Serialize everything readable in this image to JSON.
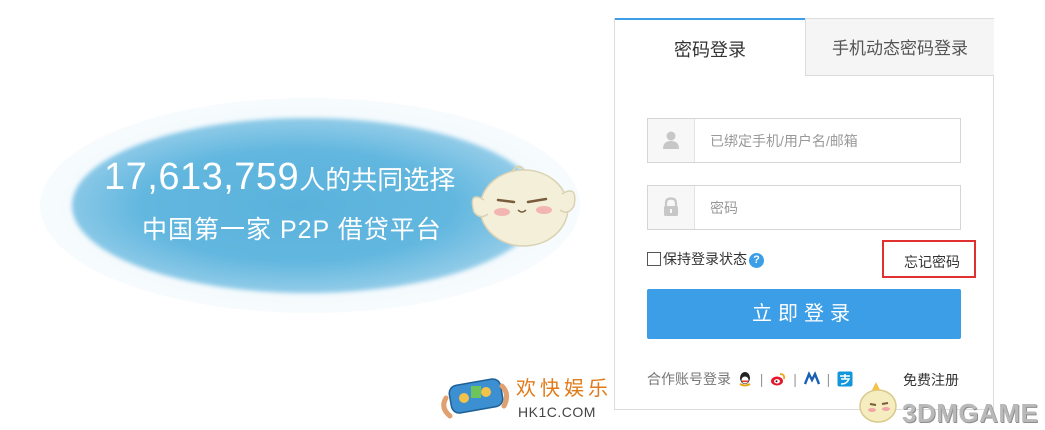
{
  "promo": {
    "count": "17,613,759",
    "count_suffix": "人的共同选择",
    "tagline": "中国第一家 P2P 借贷平台"
  },
  "login": {
    "tabs": [
      {
        "label": "密码登录",
        "active": true
      },
      {
        "label": "手机动态密码登录",
        "active": false
      }
    ],
    "username_placeholder": "已绑定手机/用户名/邮箱",
    "password_placeholder": "密码",
    "remember_label": "保持登录状态",
    "help_glyph": "?",
    "forgot_label": "忘记密码",
    "submit_label": "立即登录",
    "coop_label": "合作账号登录",
    "register_label": "免费注册",
    "social_icons": [
      "qq-icon",
      "weibo-icon",
      "renren-icon",
      "alipay-icon"
    ],
    "accent_color": "#3b9ee6",
    "highlight_color": "#e03030"
  },
  "watermarks": {
    "hk_title": "欢快娱乐",
    "hk_url": "HK1C.COM",
    "game_brand": "3DMGAME"
  }
}
